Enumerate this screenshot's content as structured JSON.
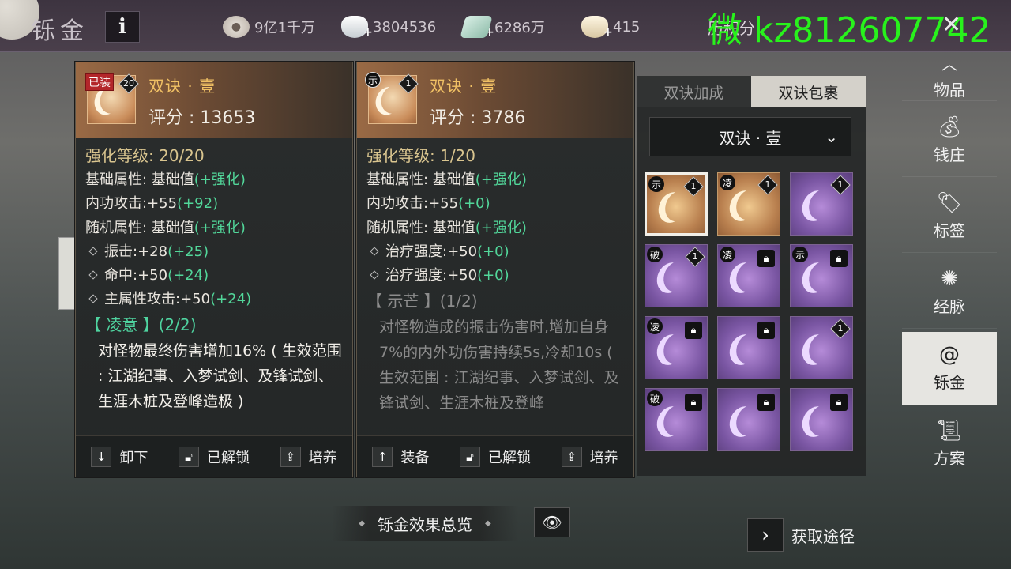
{
  "topbar": {
    "title": "铄金",
    "info_label": "i",
    "currencies": [
      {
        "icon": "coin-pouch-icon",
        "value": "9亿1千万"
      },
      {
        "icon": "silver-ingot-icon",
        "value": "3804536"
      },
      {
        "icon": "jade-ticket-icon",
        "value": "6286万"
      },
      {
        "icon": "gold-ingot-icon",
        "value": "415"
      }
    ],
    "partial_label": "历积分",
    "watermark": "微 kz812607742",
    "close_label": "✕"
  },
  "panels": [
    {
      "equipped_tag": "已装",
      "badge": "20",
      "name": "双诀 · 壹",
      "score": "评分 : 13653",
      "enhance": "强化等级:  20/20",
      "base_attr_label": "基础属性:  基础值",
      "base_attr_note": "(+强化)",
      "attack_label": "内功攻击:+55",
      "attack_bonus": "(+92)",
      "random_label": "随机属性:  基础值",
      "random_note": "(+强化)",
      "stats": [
        {
          "label": "振击:+28",
          "bonus": "(+25)"
        },
        {
          "label": "命中:+50",
          "bonus": "(+24)"
        },
        {
          "label": "主属性攻击:+50",
          "bonus": "(+24)"
        }
      ],
      "set_title": "【 凌意 】(2/2)",
      "set_desc": "对怪物最终伤害增加16% ( 生效范围 : 江湖纪事、入梦试剑、及锋试剑、生涯木桩及登峰造极 )",
      "actions": [
        {
          "icon": "arrow-down-icon",
          "label": "卸下"
        },
        {
          "icon": "unlock-icon",
          "label": "已解锁"
        },
        {
          "icon": "upgrade-icon",
          "label": "培养"
        }
      ]
    },
    {
      "badge": "1",
      "mark": "示",
      "name": "双诀 · 壹",
      "score": "评分 : 3786",
      "enhance": "强化等级:  1/20",
      "base_attr_label": "基础属性:  基础值",
      "base_attr_note": "(+强化)",
      "attack_label": "内功攻击:+55",
      "attack_bonus": "(+0)",
      "random_label": "随机属性:  基础值",
      "random_note": "(+强化)",
      "stats": [
        {
          "label": "治疗强度:+50",
          "bonus": "(+0)"
        },
        {
          "label": "治疗强度:+50",
          "bonus": "(+0)"
        }
      ],
      "set_title": "【 示芒 】(1/2)",
      "set_desc": "对怪物造成的振击伤害时,增加自身7%的内外功伤害持续5s,冷却10s ( 生效范围 : 江湖纪事、入梦试剑、及锋试剑、生涯木桩及登峰",
      "actions": [
        {
          "icon": "arrow-up-icon",
          "label": "装备"
        },
        {
          "icon": "unlock-icon",
          "label": "已解锁"
        },
        {
          "icon": "upgrade-icon",
          "label": "培养"
        }
      ]
    }
  ],
  "inventory": {
    "tabs": [
      "双诀加成",
      "双诀包裹"
    ],
    "active_tab": 1,
    "selector": "双诀 · 壹",
    "slots": [
      {
        "mark": "示",
        "count": "1",
        "locked": false,
        "rarity": "gold",
        "selected": true
      },
      {
        "mark": "凌",
        "count": "1",
        "locked": false,
        "rarity": "gold",
        "selected": false
      },
      {
        "mark": "",
        "count": "1",
        "locked": false,
        "rarity": "purple",
        "selected": false
      },
      {
        "mark": "破",
        "count": "1",
        "locked": false,
        "rarity": "purple",
        "selected": false
      },
      {
        "mark": "凌",
        "count": "",
        "locked": true,
        "rarity": "purple",
        "selected": false
      },
      {
        "mark": "示",
        "count": "",
        "locked": true,
        "rarity": "purple",
        "selected": false
      },
      {
        "mark": "凌",
        "count": "",
        "locked": true,
        "rarity": "purple",
        "selected": false
      },
      {
        "mark": "",
        "count": "",
        "locked": true,
        "rarity": "purple",
        "selected": false
      },
      {
        "mark": "",
        "count": "1",
        "locked": false,
        "rarity": "purple",
        "selected": false
      },
      {
        "mark": "破",
        "count": "",
        "locked": true,
        "rarity": "purple",
        "selected": false
      },
      {
        "mark": "",
        "count": "",
        "locked": true,
        "rarity": "purple",
        "selected": false
      },
      {
        "mark": "",
        "count": "",
        "locked": true,
        "rarity": "purple",
        "selected": false
      }
    ]
  },
  "side_nav": [
    {
      "icon": "chevron-up-icon",
      "label": "物品",
      "active": false
    },
    {
      "icon": "money-bag-icon",
      "label": "钱庄",
      "active": false
    },
    {
      "icon": "tag-icon",
      "label": "标签",
      "active": false
    },
    {
      "icon": "meridian-icon",
      "label": "经脉",
      "active": false
    },
    {
      "icon": "swirl-icon",
      "label": "铄金",
      "active": true
    },
    {
      "icon": "scroll-icon",
      "label": "方案",
      "active": false
    }
  ],
  "bottom": {
    "overview_label": "铄金效果总览",
    "eye_icon": "eye-icon",
    "obtain_label": "获取途径"
  },
  "colors": {
    "gold_text": "#f0c064",
    "green_text": "#52d79a",
    "watermark": "#28f21c",
    "equipped_tag": "#b3262a"
  }
}
